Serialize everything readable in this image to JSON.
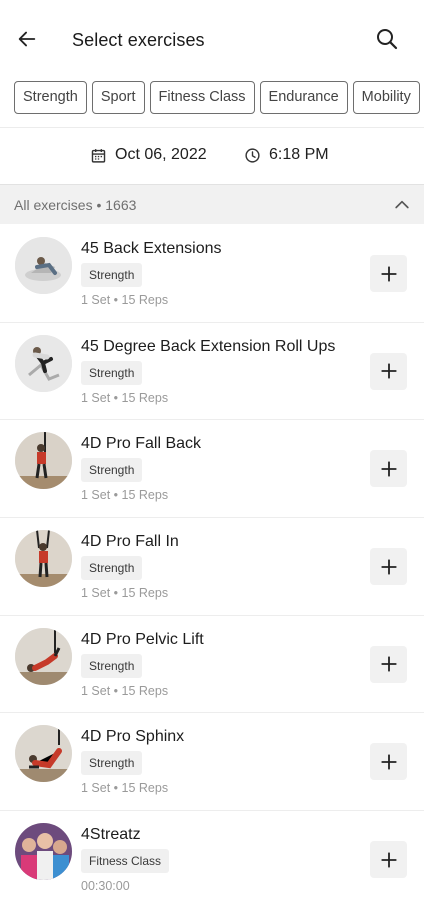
{
  "header": {
    "title": "Select exercises"
  },
  "filters": [
    "Strength",
    "Sport",
    "Fitness Class",
    "Endurance",
    "Mobility"
  ],
  "datetime": {
    "date": "Oct 06, 2022",
    "time": "6:18 PM"
  },
  "section": {
    "label": "All exercises • 1663"
  },
  "exercises": [
    {
      "name": "45 Back Extensions",
      "tag": "Strength",
      "meta": "1 Set • 15 Reps"
    },
    {
      "name": "45 Degree Back Extension Roll Ups",
      "tag": "Strength",
      "meta": "1 Set • 15 Reps"
    },
    {
      "name": "4D Pro Fall Back",
      "tag": "Strength",
      "meta": "1 Set • 15 Reps"
    },
    {
      "name": "4D Pro Fall In",
      "tag": "Strength",
      "meta": "1 Set • 15 Reps"
    },
    {
      "name": "4D Pro Pelvic Lift",
      "tag": "Strength",
      "meta": "1 Set • 15 Reps"
    },
    {
      "name": "4D Pro Sphinx",
      "tag": "Strength",
      "meta": "1 Set • 15 Reps"
    },
    {
      "name": "4Streatz",
      "tag": "Fitness Class",
      "meta": "00:30:00"
    }
  ]
}
